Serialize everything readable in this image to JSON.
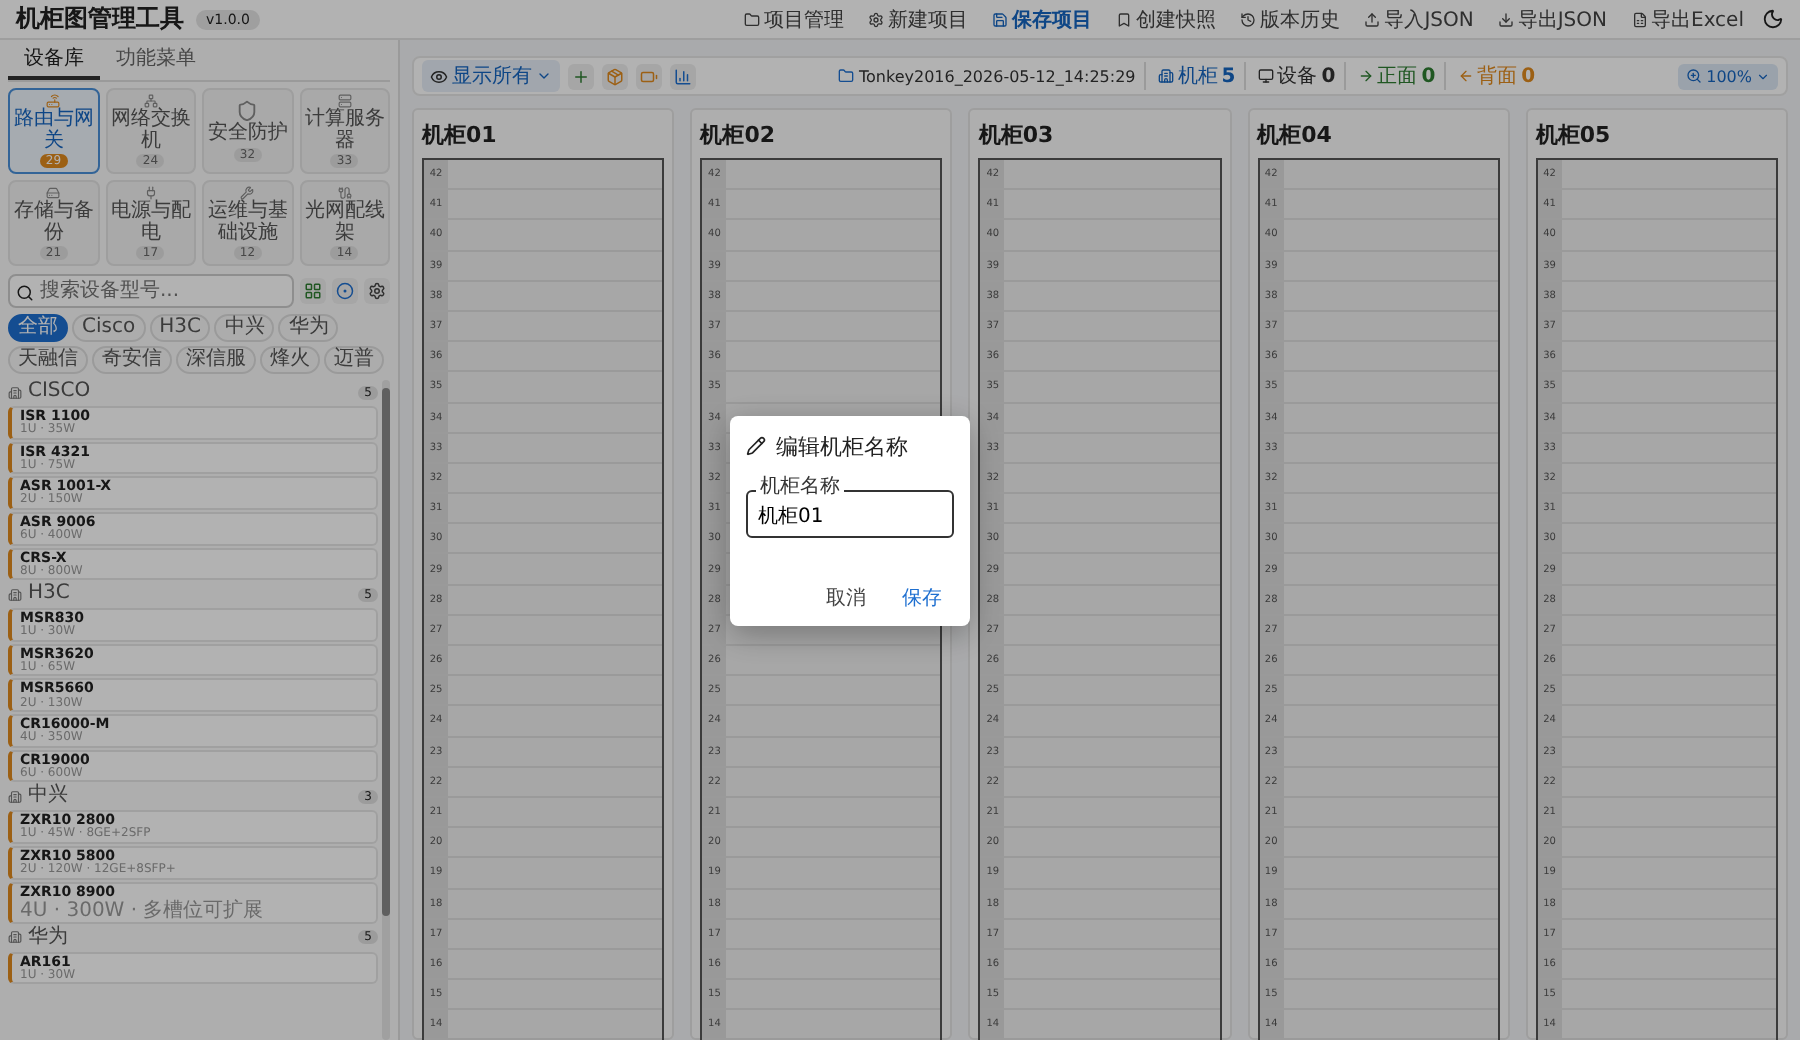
{
  "app": {
    "title": "机柜图管理工具",
    "version": "v1.0.0"
  },
  "header_actions": [
    {
      "label": "项目管理",
      "primary": false
    },
    {
      "label": "新建项目",
      "primary": false
    },
    {
      "label": "保存项目",
      "primary": true
    },
    {
      "label": "创建快照",
      "primary": false
    },
    {
      "label": "版本历史",
      "primary": false
    },
    {
      "label": "导入JSON",
      "primary": false
    },
    {
      "label": "导出JSON",
      "primary": false
    },
    {
      "label": "导出Excel",
      "primary": false
    }
  ],
  "sidebar": {
    "tabs": [
      {
        "label": "设备库",
        "selected": true
      },
      {
        "label": "功能菜单",
        "selected": false
      }
    ],
    "categories": [
      {
        "label": "路由与网关",
        "count": "29",
        "selected": true
      },
      {
        "label": "网络交换机",
        "count": "24",
        "selected": false
      },
      {
        "label": "安全防护",
        "count": "32",
        "selected": false
      },
      {
        "label": "计算服务器",
        "count": "33",
        "selected": false
      },
      {
        "label": "存储与备份",
        "count": "21",
        "selected": false
      },
      {
        "label": "电源与配电",
        "count": "17",
        "selected": false
      },
      {
        "label": "运维与基础设施",
        "count": "12",
        "selected": false
      },
      {
        "label": "光网配线架",
        "count": "14",
        "selected": false
      }
    ],
    "search": {
      "placeholder": "搜索设备型号..."
    },
    "filters": [
      {
        "label": "全部",
        "selected": true
      },
      {
        "label": "Cisco",
        "selected": false
      },
      {
        "label": "H3C",
        "selected": false
      },
      {
        "label": "中兴",
        "selected": false
      },
      {
        "label": "华为",
        "selected": false
      },
      {
        "label": "天融信",
        "selected": false
      },
      {
        "label": "奇安信",
        "selected": false
      },
      {
        "label": "深信服",
        "selected": false
      },
      {
        "label": "烽火",
        "selected": false
      },
      {
        "label": "迈普",
        "selected": false
      }
    ],
    "groups": [
      {
        "name": "CISCO",
        "count": "5",
        "devices": [
          {
            "name": "ISR 1100",
            "spec": "1U · 35W"
          },
          {
            "name": "ISR 4321",
            "spec": "1U · 75W"
          },
          {
            "name": "ASR 1001-X",
            "spec": "2U · 150W"
          },
          {
            "name": "ASR 9006",
            "spec": "6U · 400W"
          },
          {
            "name": "CRS-X",
            "spec": "8U · 800W"
          }
        ]
      },
      {
        "name": "H3C",
        "count": "5",
        "devices": [
          {
            "name": "MSR830",
            "spec": "1U · 30W"
          },
          {
            "name": "MSR3620",
            "spec": "1U · 65W"
          },
          {
            "name": "MSR5660",
            "spec": "2U · 130W"
          },
          {
            "name": "CR16000-M",
            "spec": "4U · 350W"
          },
          {
            "name": "CR19000",
            "spec": "6U · 600W"
          }
        ]
      },
      {
        "name": "中兴",
        "count": "3",
        "devices": [
          {
            "name": "ZXR10 2800",
            "spec": "1U · 45W · 8GE+2SFP"
          },
          {
            "name": "ZXR10 5800",
            "spec": "2U · 120W · 12GE+8SFP+"
          },
          {
            "name": "ZXR10 8900",
            "spec": "4U · 300W · 多槽位可扩展"
          }
        ]
      },
      {
        "name": "华为",
        "count": "5",
        "devices": [
          {
            "name": "AR161",
            "spec": "1U · 30W"
          }
        ]
      }
    ]
  },
  "toolbar": {
    "view": "显示所有",
    "project": "Tonkey2016_2026-05-12_14:25:29",
    "stats": [
      {
        "kind": "racks",
        "label": "机柜",
        "value": "5"
      },
      {
        "kind": "devices",
        "label": "设备",
        "value": "0"
      },
      {
        "kind": "front",
        "label": "正面",
        "value": "0"
      },
      {
        "kind": "back",
        "label": "背面",
        "value": "0"
      }
    ],
    "zoom": "100%"
  },
  "racks": [
    {
      "name": "机柜01",
      "units": [
        "42",
        "41",
        "40",
        "39",
        "38",
        "37",
        "36",
        "35",
        "34",
        "33",
        "32",
        "31",
        "30",
        "29",
        "28",
        "27",
        "26",
        "25",
        "24",
        "23",
        "22",
        "21",
        "20",
        "19",
        "18",
        "17",
        "16",
        "15",
        "14"
      ]
    },
    {
      "name": "机柜02",
      "units": [
        "42",
        "41",
        "40",
        "39",
        "38",
        "37",
        "36",
        "35",
        "34",
        "33",
        "32",
        "31",
        "30",
        "29",
        "28",
        "27",
        "26",
        "25",
        "24",
        "23",
        "22",
        "21",
        "20",
        "19",
        "18",
        "17",
        "16",
        "15",
        "14"
      ]
    },
    {
      "name": "机柜03",
      "units": [
        "42",
        "41",
        "40",
        "39",
        "38",
        "37",
        "36",
        "35",
        "34",
        "33",
        "32",
        "31",
        "30",
        "29",
        "28",
        "27",
        "26",
        "25",
        "24",
        "23",
        "22",
        "21",
        "20",
        "19",
        "18",
        "17",
        "16",
        "15",
        "14"
      ]
    },
    {
      "name": "机柜04",
      "units": [
        "42",
        "41",
        "40",
        "39",
        "38",
        "37",
        "36",
        "35",
        "34",
        "33",
        "32",
        "31",
        "30",
        "29",
        "28",
        "27",
        "26",
        "25",
        "24",
        "23",
        "22",
        "21",
        "20",
        "19",
        "18",
        "17",
        "16",
        "15",
        "14"
      ]
    },
    {
      "name": "机柜05",
      "units": [
        "42",
        "41",
        "40",
        "39",
        "38",
        "37",
        "36",
        "35",
        "34",
        "33",
        "32",
        "31",
        "30",
        "29",
        "28",
        "27",
        "26",
        "25",
        "24",
        "23",
        "22",
        "21",
        "20",
        "19",
        "18",
        "17",
        "16",
        "15",
        "14"
      ]
    }
  ],
  "dialog": {
    "title": "编辑机柜名称",
    "field_label": "机柜名称",
    "value": "机柜01",
    "buttons": [
      {
        "label": "取消",
        "kind": "cancel"
      },
      {
        "label": "保存",
        "kind": "save"
      }
    ]
  }
}
